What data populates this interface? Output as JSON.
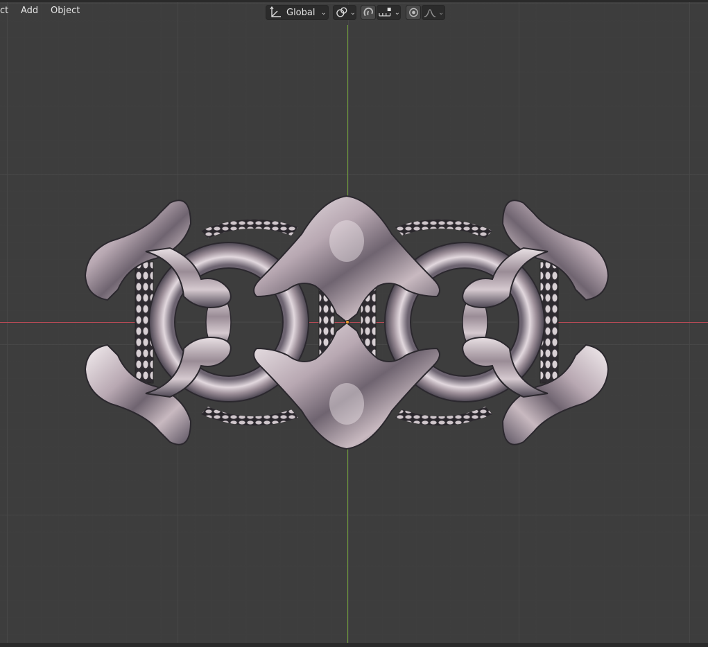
{
  "header": {
    "menu": {
      "select_partial": "ct",
      "add": "Add",
      "object": "Object"
    },
    "orientation": {
      "label": "Global",
      "icon": "transform-orientation-icon"
    },
    "pivot_icon": "pivot-point-icon",
    "snap_icon": "magnet-icon",
    "snap_target_icon": "snap-increment-icon",
    "proportional_icon": "proportional-editing-icon",
    "falloff_icon": "falloff-curve-icon"
  },
  "viewport": {
    "colors": {
      "background": "#3d3d3d",
      "x_axis": "#b64a55",
      "y_axis": "#74a03d",
      "origin": "#f2a030"
    },
    "object": "ornate-ring-mesh"
  }
}
